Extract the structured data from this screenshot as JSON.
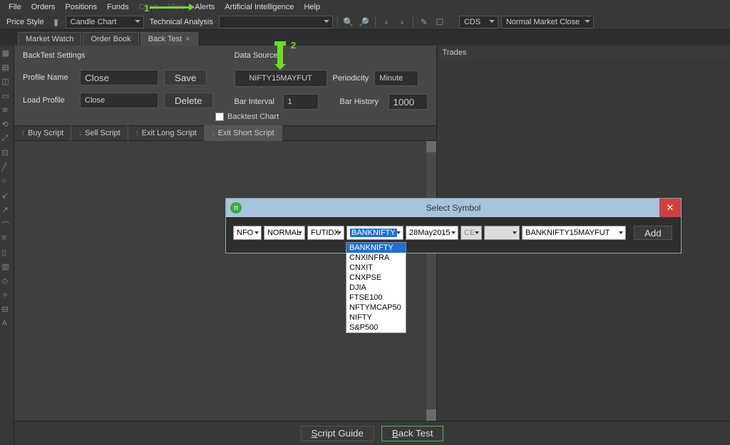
{
  "menu": {
    "items": [
      "File",
      "Orders",
      "Positions",
      "Funds",
      "Chart",
      "View",
      "Alerts",
      "Artificial Intelligence",
      "Help"
    ]
  },
  "toolbar": {
    "priceStyleLabel": "Price Style",
    "priceStyleValue": "Candle Chart",
    "taLabel": "Technical Analysis",
    "taValue": "",
    "rightSelect1": "CDS",
    "rightSelect2": "Normal Market Close"
  },
  "tabs": {
    "items": [
      "Market Watch",
      "Order Book",
      "Back Test"
    ],
    "activeIndex": 2
  },
  "settings": {
    "heading": "BackTest Settings",
    "profileNameLabel": "Profile Name",
    "profileNameValue": "Close",
    "saveLabel": "Save",
    "loadProfileLabel": "Load Profile",
    "loadProfileValue": "Close",
    "deleteLabel": "Delete",
    "dataSourceHeading": "Data Source",
    "dataSourceValue": "NIFTY15MAYFUT",
    "periodicityLabel": "Periodicity",
    "periodicityValue": "Minute",
    "barIntervalLabel": "Bar Interval",
    "barIntervalValue": "1",
    "barHistoryLabel": "Bar History",
    "barHistoryValue": "1000",
    "backtestChartLabel": "Backtest Chart"
  },
  "scriptTabs": [
    "Buy Script",
    "Sell Script",
    "Exit Long Script",
    "Exit Short Script"
  ],
  "trades": {
    "heading": "Trades"
  },
  "footer": {
    "scriptGuide": "Script Guide",
    "backTest": "Back Test"
  },
  "dialog": {
    "title": "Select Symbol",
    "pi": "π",
    "sel1": "NFO",
    "sel2": "NORMAL",
    "sel3": "FUTIDX",
    "sel4": "BANKNIFTY",
    "sel5": "28May2015",
    "sel6": "CE",
    "sel7": "",
    "sel8": "BANKNIFTY15MAYFUT",
    "addLabel": "Add",
    "dropdownOptions": [
      "BANKNIFTY",
      "CNXINFRA",
      "CNXIT",
      "CNXPSE",
      "DJIA",
      "FTSE100",
      "NFTYMCAP50",
      "NIFTY",
      "S&P500"
    ]
  },
  "annotations": {
    "a1": "1",
    "a2": "2"
  }
}
